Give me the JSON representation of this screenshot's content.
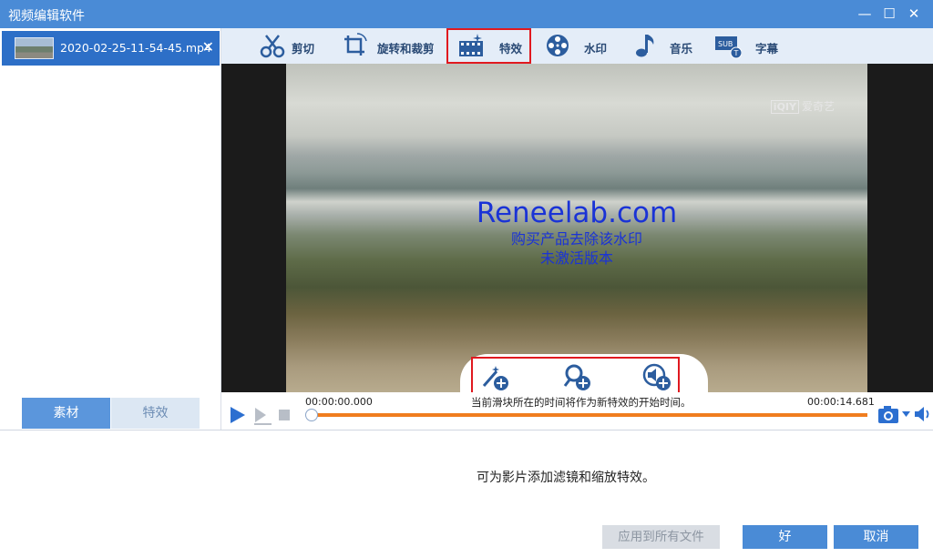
{
  "window": {
    "title": "视频编辑软件"
  },
  "file_list": {
    "items": [
      {
        "name": "2020-02-25-11-54-45.mp4"
      }
    ]
  },
  "left_tabs": {
    "material": "素材",
    "effects": "特效"
  },
  "toolbar": {
    "items": [
      {
        "label": "剪切",
        "icon": "scissors-icon"
      },
      {
        "label": "旋转和裁剪",
        "icon": "crop-rotate-icon"
      },
      {
        "label": "特效",
        "icon": "film-effects-icon",
        "selected": true
      },
      {
        "label": "水印",
        "icon": "watermark-reel-icon"
      },
      {
        "label": "音乐",
        "icon": "music-note-icon"
      },
      {
        "label": "字幕",
        "icon": "subtitle-icon"
      }
    ]
  },
  "video": {
    "overlay_logo": "爱奇艺",
    "overlay_logo_box": "iQIY",
    "watermark": {
      "line1": "Reneelab.com",
      "line2": "购买产品去除该水印",
      "line3": "未激活版本"
    }
  },
  "effect_buttons": [
    "add-filter-icon",
    "add-zoom-icon",
    "add-audio-effect-icon"
  ],
  "playback": {
    "time_start": "00:00:00.000",
    "time_end": "00:00:14.681",
    "hint": "当前滑块所在的时间将作为新特效的开始时间。",
    "progress": 0
  },
  "bottom": {
    "description": "可为影片添加滤镜和缩放特效。",
    "apply_all": "应用到所有文件",
    "ok": "好",
    "cancel": "取消"
  },
  "colors": {
    "accent": "#4a8bd6",
    "highlight": "#e0191f",
    "progress": "#f07d1f"
  }
}
